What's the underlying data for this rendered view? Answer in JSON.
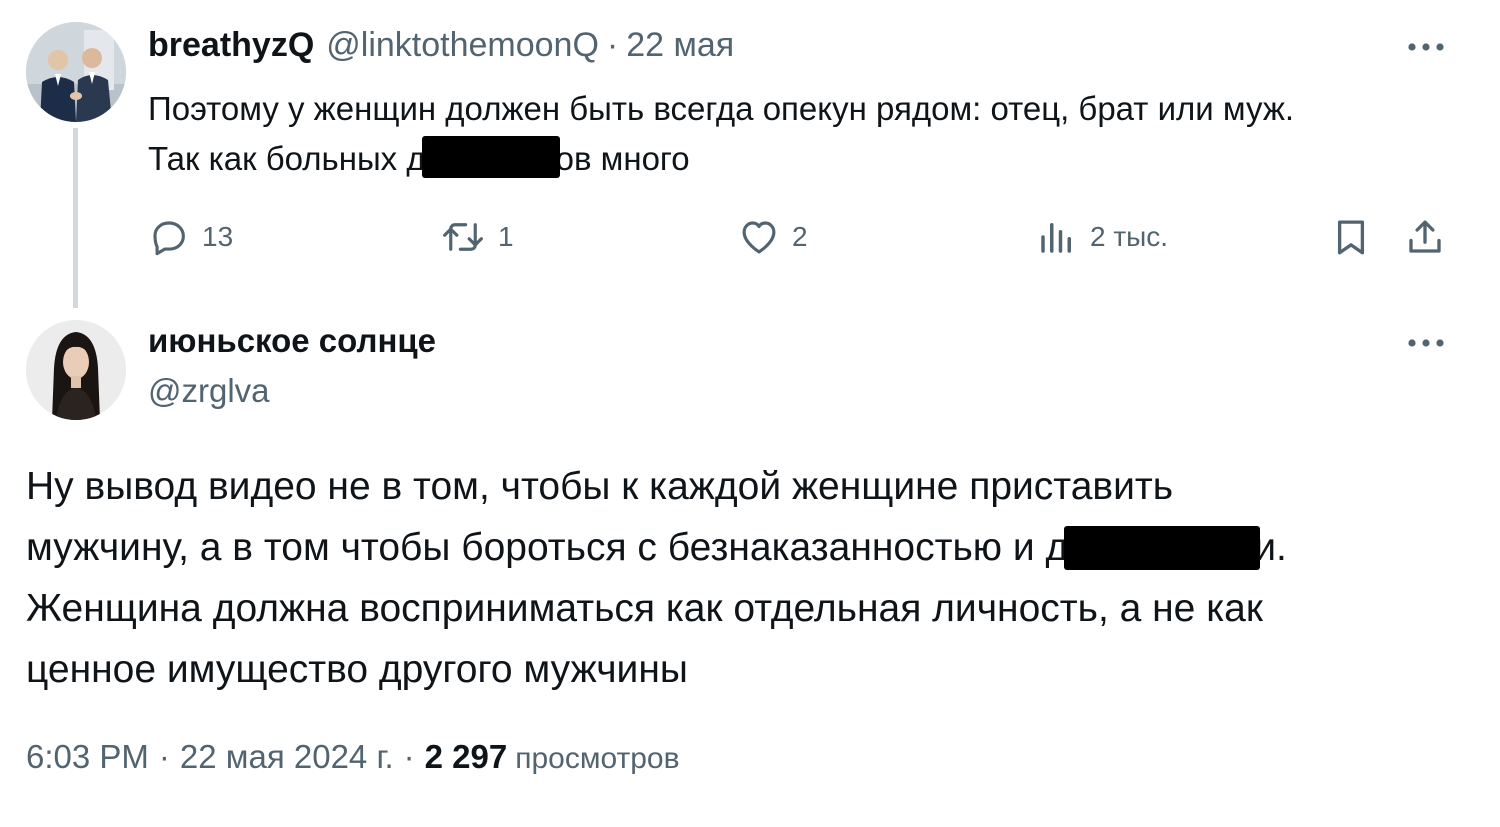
{
  "parent": {
    "display_name": "breathyzQ",
    "handle": "@linktothemoonQ",
    "separator": "·",
    "date": "22 мая",
    "text_line1": "Поэтому у женщин должен быть всегда опекун рядом: отец, брат или муж.",
    "text_line2_before": "Так как больных д",
    "text_line2_after": "ов много",
    "actions": {
      "replies": "13",
      "retweets": "1",
      "likes": "2",
      "views": "2 тыс."
    }
  },
  "main": {
    "display_name": "июньское солнце",
    "handle": "@zrglva",
    "text_line1": "Ну вывод видео не в том, чтобы к каждой женщине приставить",
    "text_line2_before": "мужчину, а в том чтобы бороться с безнаказанностью и д",
    "text_line2_after": "и.",
    "text_line3": "Женщина должна восприниматься как отдельная личность, а не как",
    "text_line4": "ценное имущество другого мужчины",
    "time": "6:03 PM",
    "separator": "·",
    "date": "22 мая 2024 г.",
    "views_count": "2 297",
    "views_label": "просмотров"
  },
  "icons": {
    "more": "more-horizontal-icon",
    "reply": "reply-bubble-icon",
    "retweet": "retweet-icon",
    "like": "heart-icon",
    "views": "views-bars-icon",
    "bookmark": "bookmark-icon",
    "share": "share-upload-icon"
  },
  "colors": {
    "text_primary": "#0f1419",
    "text_secondary": "#536471",
    "thread_line": "#cfd9de",
    "redaction": "#000000"
  }
}
